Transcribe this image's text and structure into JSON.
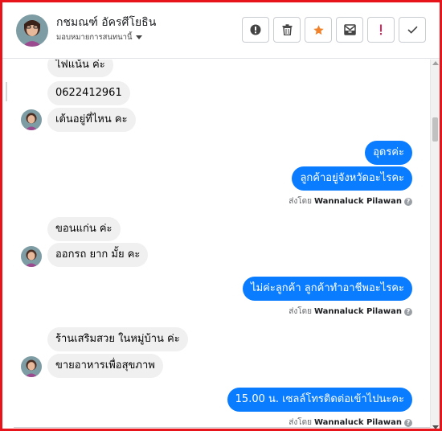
{
  "header": {
    "contact_name": "กชมณฑ์ อัครศีโยธิน",
    "assign_label": "มอบหมายการสนทนานี้",
    "toolbar": [
      {
        "name": "spam-button",
        "icon": "exclamation-circle-icon",
        "color": "#444444"
      },
      {
        "name": "delete-button",
        "icon": "trash-icon",
        "color": "#444444"
      },
      {
        "name": "star-button",
        "icon": "star-icon",
        "color": "#f0822c"
      },
      {
        "name": "archive-button",
        "icon": "archive-icon",
        "color": "#444444"
      },
      {
        "name": "mark-urgent-button",
        "icon": "exclamation-icon",
        "color": "#e0245e"
      },
      {
        "name": "mark-done-button",
        "icon": "check-icon",
        "color": "#444444"
      }
    ]
  },
  "messages": {
    "m1": "ไฟแน้น ค่ะ",
    "m2": "0622412961",
    "m3": "เต้นอยู่ที่ไหน คะ",
    "m4": "อุดรค่ะ",
    "m5": "ลูกค้าอยู่จังหวัดอะไรคะ",
    "m6": "ขอนแก่น ค่ะ",
    "m7": "ออกรถ ยาก มั้ย คะ",
    "m8": "ไม่ค่ะลูกค้า ลูกค้าทำอาชีพอะไรคะ",
    "m9": "ร้านเสริมสวย ในหมู่บ้าน ค่ะ",
    "m10": "ขายอาหารเพื่อสุขภาพ",
    "m11": "15.00  น.  เซลล์โทรติดต่อเข้าไปนะคะ"
  },
  "sent_by": {
    "prefix": "ส่งโดย",
    "agent": "Wannaluck Pilawan",
    "help_glyph": "?"
  },
  "colors": {
    "outgoing": "#0a7cff",
    "incoming": "#f0f0f0",
    "frame_border": "#e8141b"
  }
}
